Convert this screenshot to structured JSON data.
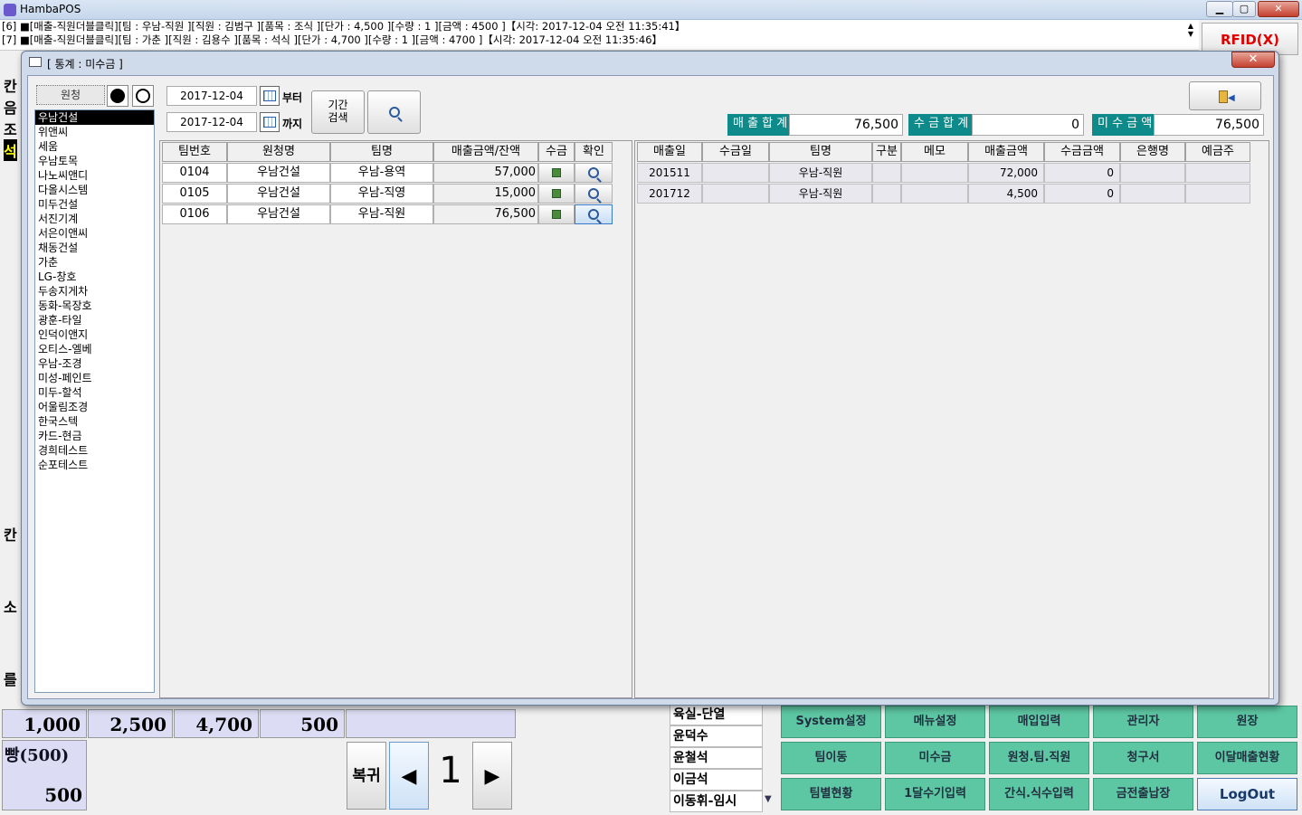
{
  "app": {
    "title": "HambaPOS",
    "min": "▁",
    "max": "▢",
    "close": "✕"
  },
  "log": [
    "[6] ■[매출-직원더블클릭][팀 : 우남-직원 ][직원 : 김범구 ][품목 : 조식 ][단가 : 4,500 ][수량 : 1 ][금액 : 4500 ]【시각: 2017-12-04 오전 11:35:41】",
    "[7] ■[매출-직원더블클릭][팀 : 가춘 ][직원 : 김용수 ][품목 : 석식 ][단가 : 4,700 ][수량 : 1 ][금액 : 4700 ]【시각: 2017-12-04 오전 11:35:46】"
  ],
  "rfid": "RFID(X)",
  "bg_side": [
    "칸",
    "음",
    "조",
    "석",
    "칸",
    "소",
    "를"
  ],
  "price_strip": [
    "1,000",
    "2,500",
    "4,700",
    "500"
  ],
  "bread": {
    "name": "빵(500)",
    "price": "500"
  },
  "nav": {
    "back": "복귀",
    "prev": "◀",
    "page": "1",
    "next": "▶"
  },
  "names": [
    "육실-단열",
    "윤덕수",
    "윤철석",
    "이금석",
    "이동휘-임시"
  ],
  "green_buttons": [
    [
      "System설정",
      "메뉴설정",
      "매입입력",
      "관리자",
      "원장"
    ],
    [
      "팀이동",
      "미수금",
      "원청.팀.직원",
      "청구서",
      "이달매출현황"
    ],
    [
      "팀별현황",
      "1달수기입력",
      "간식.식수입력",
      "금전출납장",
      "LogOut"
    ]
  ],
  "dialog": {
    "title": "[ 통계 : 미수금 ]",
    "close": "✕",
    "wonchung_label": "원청",
    "clients": [
      "우남건설",
      "위앤씨",
      "세움",
      "우남토목",
      "나노씨앤디",
      "다올시스템",
      "미두건설",
      "서진기계",
      "서은이앤씨",
      "채동건설",
      "가춘",
      "LG-창호",
      "두송지게차",
      "동화-목장호",
      "광훈-타일",
      "인덕이앤지",
      "오티스-엘베",
      "우남-조경",
      "미성-페인트",
      "미두-할석",
      "어울림조경",
      "한국스텍",
      "카드-현금",
      "경희테스트",
      "순포테스트"
    ],
    "date_from": "2017-12-04",
    "date_to": "2017-12-04",
    "from_label": "부터",
    "to_label": "까지",
    "period_search": "기간\n검색",
    "summary": {
      "sales_label": "매 출 합 계",
      "sales": "76,500",
      "collected_label": "수 금 합 계",
      "collected": "0",
      "unpaid_label": "미 수 금 액",
      "unpaid": "76,500"
    },
    "left_headers": [
      "팀번호",
      "원청명",
      "팀명",
      "매출금액/잔액",
      "수금",
      "확인"
    ],
    "left_rows": [
      [
        "0104",
        "우남건설",
        "우남-용역",
        "57,000"
      ],
      [
        "0105",
        "우남건설",
        "우남-직영",
        "15,000"
      ],
      [
        "0106",
        "우남건설",
        "우남-직원",
        "76,500"
      ]
    ],
    "right_headers": [
      "매출일",
      "수금일",
      "팀명",
      "구분",
      "메모",
      "매출금액",
      "수금금액",
      "은행명",
      "예금주"
    ],
    "right_rows": [
      [
        "201511",
        "",
        "우남-직원",
        "",
        "",
        "72,000",
        "0",
        "",
        ""
      ],
      [
        "201712",
        "",
        "우남-직원",
        "",
        "",
        "4,500",
        "0",
        "",
        ""
      ]
    ]
  }
}
